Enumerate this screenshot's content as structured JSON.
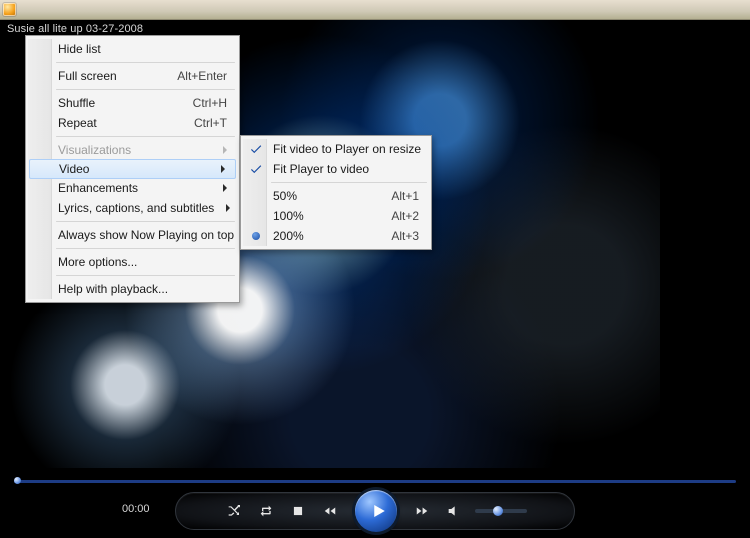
{
  "title": "Susie all lite up 03-27-2008",
  "main_menu": {
    "items": [
      {
        "label": "Hide list",
        "accel": "",
        "arrow": false,
        "disabled": false,
        "sep_after": true
      },
      {
        "label": "Full screen",
        "accel": "Alt+Enter",
        "arrow": false,
        "disabled": false,
        "sep_after": true
      },
      {
        "label": "Shuffle",
        "accel": "Ctrl+H",
        "arrow": false,
        "disabled": false,
        "sep_after": false
      },
      {
        "label": "Repeat",
        "accel": "Ctrl+T",
        "arrow": false,
        "disabled": false,
        "sep_after": true
      },
      {
        "label": "Visualizations",
        "accel": "",
        "arrow": true,
        "disabled": true,
        "sep_after": false
      },
      {
        "label": "Video",
        "accel": "",
        "arrow": true,
        "disabled": false,
        "sep_after": false,
        "selected": true
      },
      {
        "label": "Enhancements",
        "accel": "",
        "arrow": true,
        "disabled": false,
        "sep_after": false
      },
      {
        "label": "Lyrics, captions, and subtitles",
        "accel": "",
        "arrow": true,
        "disabled": false,
        "sep_after": true
      },
      {
        "label": "Always show Now Playing on top",
        "accel": "",
        "arrow": false,
        "disabled": false,
        "sep_after": true
      },
      {
        "label": "More options...",
        "accel": "",
        "arrow": false,
        "disabled": false,
        "sep_after": true
      },
      {
        "label": "Help with playback...",
        "accel": "",
        "arrow": false,
        "disabled": false,
        "sep_after": false
      }
    ]
  },
  "video_menu": {
    "items": [
      {
        "label": "Fit video to Player on resize",
        "accel": "",
        "mark": "check"
      },
      {
        "label": "Fit Player to video",
        "accel": "",
        "mark": "check",
        "sep_after": true
      },
      {
        "label": "50%",
        "accel": "Alt+1",
        "mark": ""
      },
      {
        "label": "100%",
        "accel": "Alt+2",
        "mark": ""
      },
      {
        "label": "200%",
        "accel": "Alt+3",
        "mark": "radio"
      }
    ]
  },
  "playback": {
    "time": "00:00"
  },
  "controls": {
    "shuffle": "shuffle-icon",
    "repeat": "repeat-icon",
    "stop": "stop-icon",
    "rewind": "rewind-icon",
    "play": "play-icon",
    "fastfwd": "fast-forward-icon",
    "mute": "speaker-icon"
  }
}
